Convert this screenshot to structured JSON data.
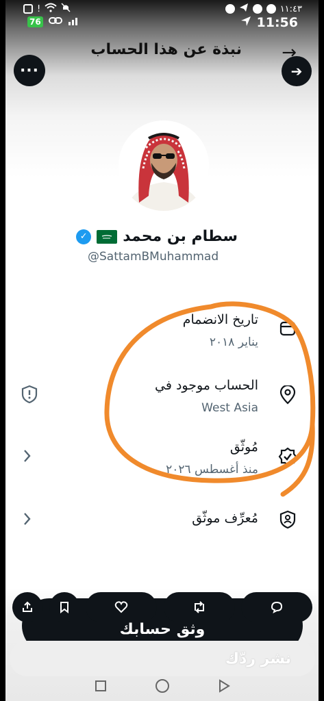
{
  "status_bar": {
    "battery": "76",
    "time_top": "١١:٤٣",
    "time": "11:56"
  },
  "header": {
    "title": "نبذة عن هذا الحساب"
  },
  "profile": {
    "name": "سطام بن محمد",
    "handle": "@SattamBMuhammad"
  },
  "info": {
    "joined_title": "تاريخ الانضمام",
    "joined_value": "يناير ٢٠١٨",
    "location_title": "الحساب موجود في",
    "location_value": "West Asia",
    "verified_title": "مُوثّق",
    "verified_value": "منذ أغسطس ٢٠٢٦",
    "id_verified_title": "مُعرِّف موثّق"
  },
  "bottom": {
    "follow_label": "وثق حسابك",
    "reply_placeholder": "نشر ردّك"
  },
  "colors": {
    "annotation": "#f08a2c",
    "verified_blue": "#1d9bf0",
    "flag_green": "#006c35"
  }
}
